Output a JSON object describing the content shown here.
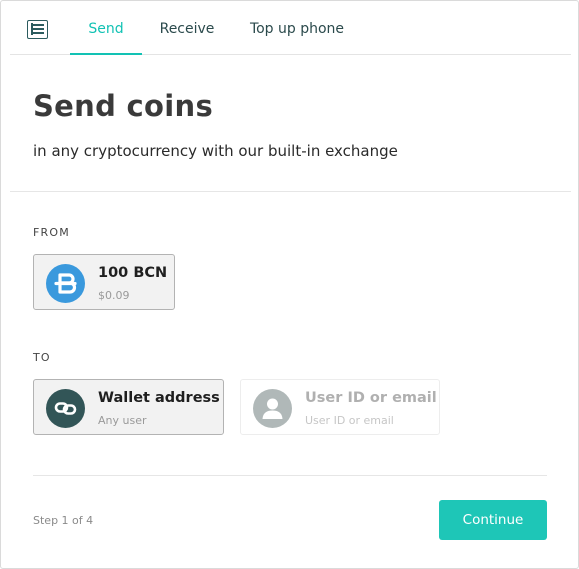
{
  "tabs": {
    "menu_icon": "list-menu-icon",
    "items": [
      {
        "label": "Send",
        "active": true
      },
      {
        "label": "Receive",
        "active": false
      },
      {
        "label": "Top up phone",
        "active": false
      }
    ]
  },
  "header": {
    "title": "Send coins",
    "subtitle": "in any cryptocurrency with our built-in exchange"
  },
  "from": {
    "label": "FROM",
    "asset": {
      "amount": "100 BCN",
      "fiat": "$0.09",
      "icon": "bytecoin-icon",
      "icon_color": "#3a99dd",
      "selected": true
    }
  },
  "to": {
    "label": "TO",
    "options": [
      {
        "title": "Wallet address",
        "subtitle": "Any user",
        "icon": "link-icon",
        "icon_color": "#325557",
        "selected": true
      },
      {
        "title": "User ID or email",
        "subtitle": "User ID or email",
        "icon": "user-icon",
        "icon_color": "#b0b8b8",
        "selected": false
      }
    ]
  },
  "footer": {
    "step": "Step 1 of 4",
    "continue_label": "Continue",
    "continue_color": "#1ec6b7"
  },
  "colors": {
    "accent": "#12c2b4",
    "tab_text": "#2b4a4c"
  }
}
